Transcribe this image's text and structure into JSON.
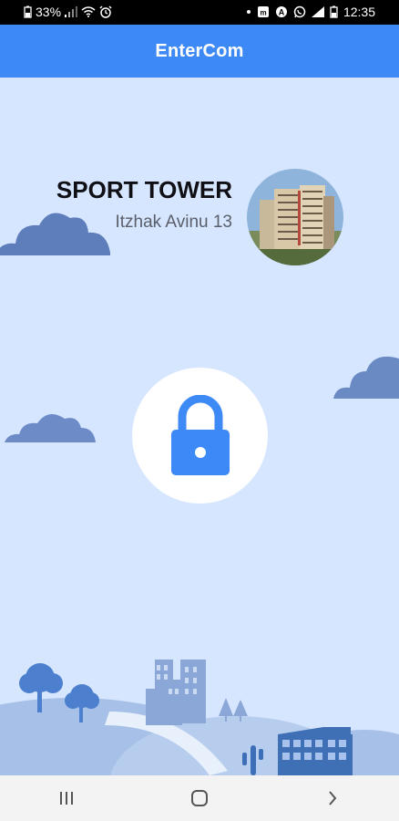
{
  "status_bar": {
    "battery": "33%",
    "time": "12:35",
    "icons": [
      "battery-icon",
      "signal-icon",
      "wifi-icon",
      "alarm-icon",
      "dot-icon",
      "notification-icon",
      "n-icon",
      "whatsapp-icon"
    ]
  },
  "app": {
    "title": "EnterCom"
  },
  "building": {
    "name": "SPORT TOWER",
    "address": "Itzhak Avinu 13"
  },
  "lock": {
    "icon": "lock-icon",
    "color": "#3d89f5"
  },
  "colors": {
    "accent": "#3d89f5",
    "background": "#d6e6ff"
  },
  "nav": {
    "buttons": [
      "recent-apps-icon",
      "home-icon",
      "back-icon"
    ]
  }
}
